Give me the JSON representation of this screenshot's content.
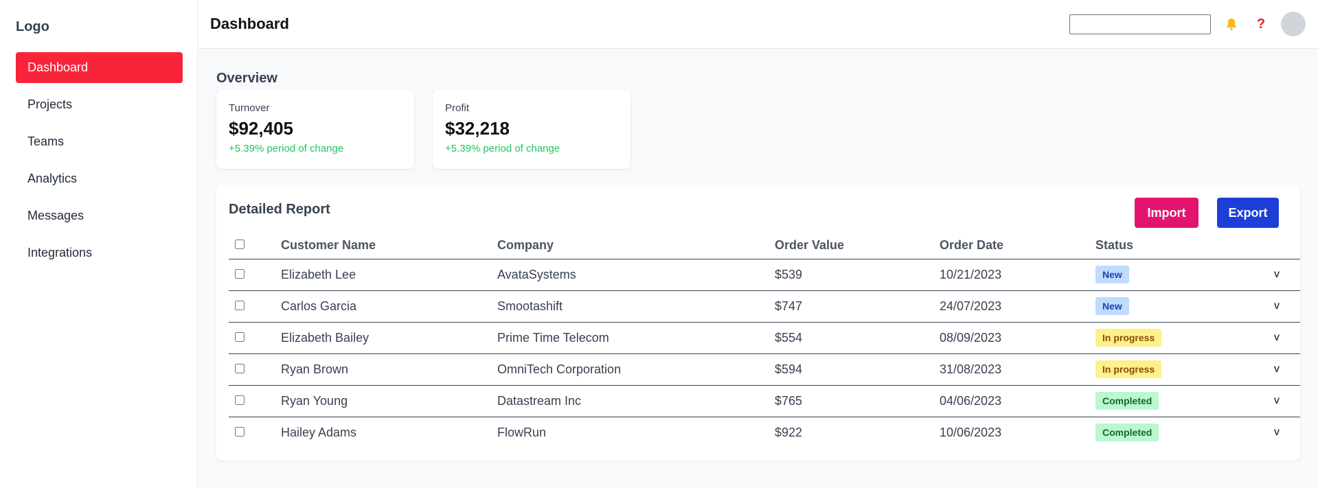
{
  "sidebar": {
    "logo": "Logo",
    "items": [
      {
        "label": "Dashboard",
        "active": true
      },
      {
        "label": "Projects"
      },
      {
        "label": "Teams"
      },
      {
        "label": "Analytics"
      },
      {
        "label": "Messages"
      },
      {
        "label": "Integrations"
      }
    ]
  },
  "header": {
    "title": "Dashboard",
    "search_value": "",
    "icons": [
      "bell-icon",
      "help-icon",
      "avatar"
    ],
    "help_glyph": "?"
  },
  "overview": {
    "title": "Overview",
    "cards": [
      {
        "label": "Turnover",
        "value": "$92,405",
        "change": "+5.39% period of change"
      },
      {
        "label": "Profit",
        "value": "$32,218",
        "change": "+5.39% period of change"
      }
    ]
  },
  "report": {
    "title": "Detailed Report",
    "import_label": "Import",
    "export_label": "Export",
    "columns": [
      "Customer Name",
      "Company",
      "Order Value",
      "Order Date",
      "Status"
    ],
    "expand_glyph": "v",
    "rows": [
      {
        "name": "Elizabeth Lee",
        "company": "AvataSystems",
        "value": "$539",
        "date": "10/21/2023",
        "status": "New"
      },
      {
        "name": "Carlos Garcia",
        "company": "Smootashift",
        "value": "$747",
        "date": "24/07/2023",
        "status": "New"
      },
      {
        "name": "Elizabeth Bailey",
        "company": "Prime Time Telecom",
        "value": "$554",
        "date": "08/09/2023",
        "status": "In progress"
      },
      {
        "name": "Ryan Brown",
        "company": "OmniTech Corporation",
        "value": "$594",
        "date": "31/08/2023",
        "status": "In progress"
      },
      {
        "name": "Ryan Young",
        "company": "Datastream Inc",
        "value": "$765",
        "date": "04/06/2023",
        "status": "Completed"
      },
      {
        "name": "Hailey Adams",
        "company": "FlowRun",
        "value": "$922",
        "date": "10/06/2023",
        "status": "Completed"
      }
    ]
  },
  "colors": {
    "active_nav": "#f9243a",
    "import_button": "#e3146e",
    "export_button": "#1d3fd8",
    "positive_change": "#22c55e",
    "badge_new": "#bfdbfe",
    "badge_in_progress": "#fef08a",
    "badge_completed": "#bbf7d0"
  }
}
